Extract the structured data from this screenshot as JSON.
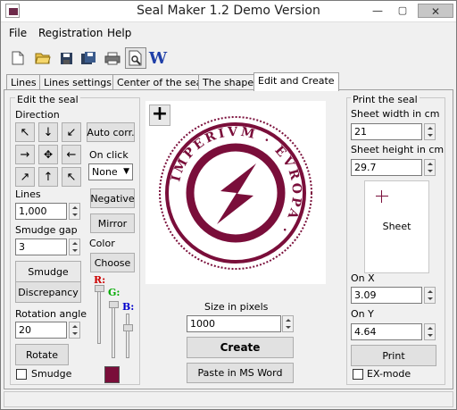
{
  "window": {
    "title": "Seal Maker 1.2 Demo Version",
    "close_symbol": "✕"
  },
  "menu": [
    "File",
    "Registration",
    "Help"
  ],
  "toolbar": {
    "icons": [
      "new-file-icon",
      "open-folder-icon",
      "save-icon",
      "save-as-icon",
      "print-icon",
      "print-preview-icon",
      "word-icon"
    ],
    "word_glyph": "W"
  },
  "tabs": [
    "Lines",
    "Lines settings",
    "Center of the seal",
    "The shape",
    "Edit and Create"
  ],
  "active_tab": "Edit and Create",
  "edit": {
    "group_label": "Edit the seal",
    "direction_label": "Direction",
    "auto_corr": "Auto corr.",
    "on_click_label": "On click",
    "on_click_value": "None",
    "lines_label": "Lines",
    "lines_value": "1,000",
    "smudge_gap_label": "Smudge gap",
    "smudge_gap_value": "3",
    "negative": "Negative",
    "mirror": "Mirror",
    "color_label": "Color",
    "choose": "Choose",
    "smudge_button": "Smudge",
    "discrepancy_button": "Discrepancy",
    "rotation_label": "Rotation angle",
    "rotation_value": "20",
    "rotate_button": "Rotate",
    "smudge_checkbox": "Smudge",
    "r_label": "R:",
    "g_label": "G:",
    "b_label": "B:",
    "seal_color": "#7a0e3a"
  },
  "seal": {
    "plus": "+",
    "ring_text": "IMPERIVM · EVROPA ·"
  },
  "create": {
    "size_label": "Size in pixels",
    "size_value": "1000",
    "create_button": "Create",
    "paste_button": "Paste in MS Word"
  },
  "print": {
    "group_label": "Print the seal",
    "width_label": "Sheet width in cm",
    "width_value": "21",
    "height_label": "Sheet height in cm",
    "height_value": "29.7",
    "sheet_label": "Sheet",
    "on_x_label": "On X",
    "on_x_value": "3.09",
    "on_y_label": "On Y",
    "on_y_value": "4.64",
    "print_button": "Print",
    "ex_mode_label": "EX-mode"
  }
}
